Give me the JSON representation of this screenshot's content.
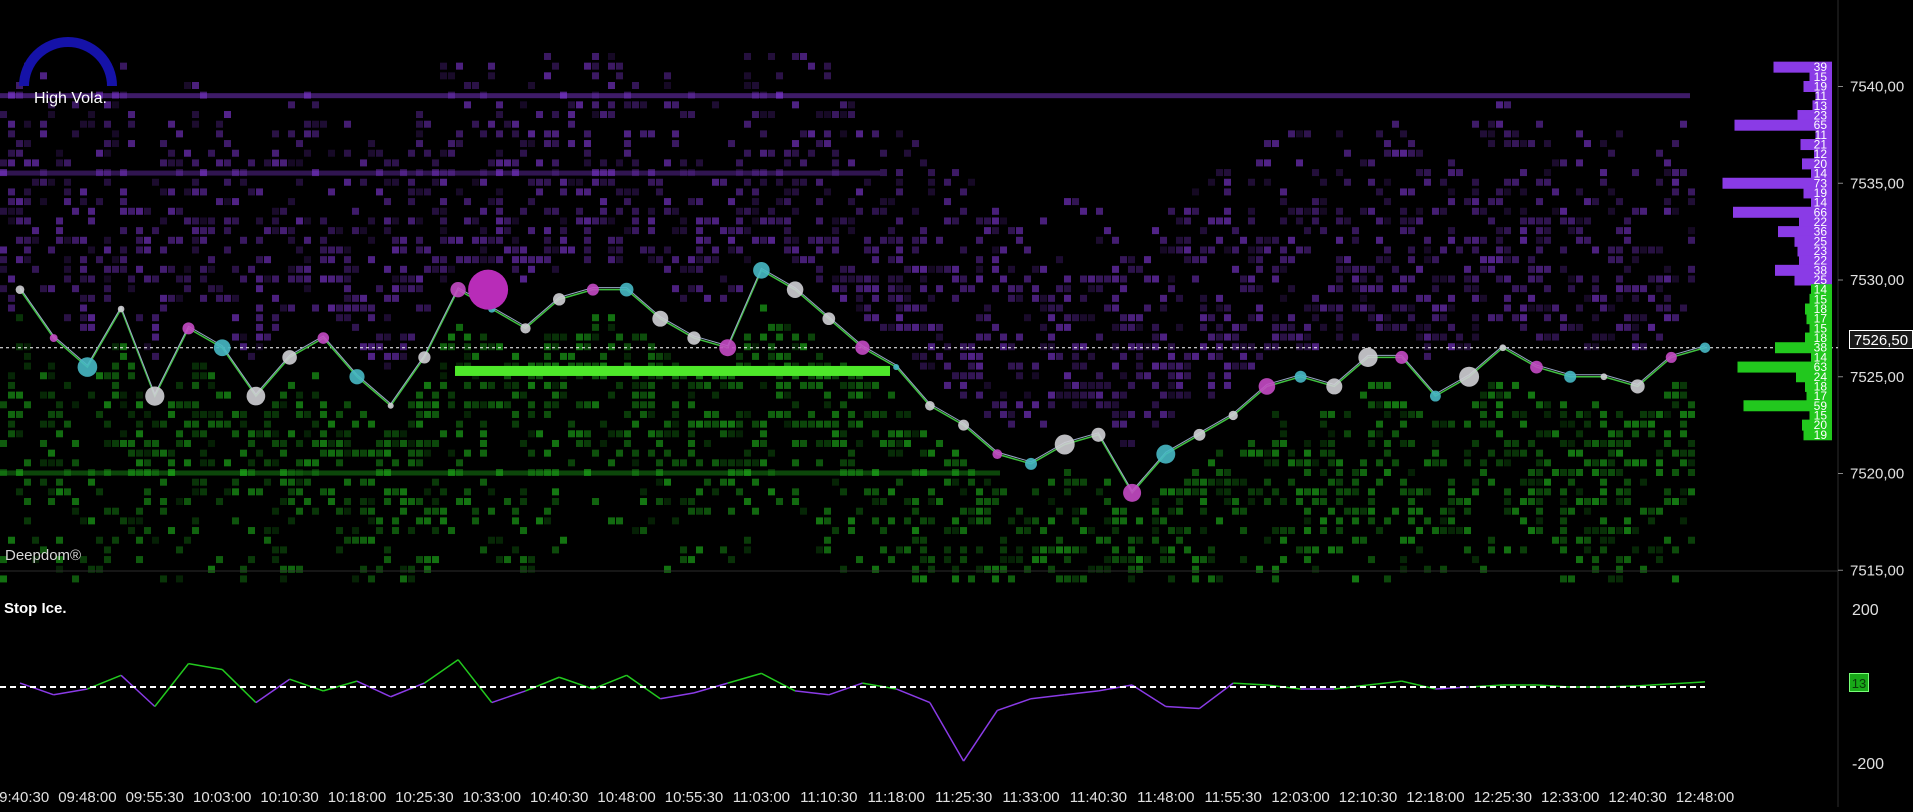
{
  "indicator_badge": {
    "label": "High Vola."
  },
  "brand": "Deepdom®",
  "lower_panel": {
    "title": "Stop Ice.",
    "axis_max": "200",
    "axis_min": "-200",
    "current_value": "13"
  },
  "price_axis": {
    "ticks": [
      "7540,00",
      "7535,00",
      "7530,00",
      "7525,00",
      "7520,00",
      "7515,00"
    ],
    "current_price": "7526,50"
  },
  "time_axis": [
    "09:40:30",
    "09:48:00",
    "09:55:30",
    "10:03:00",
    "10:10:30",
    "10:18:00",
    "10:25:30",
    "10:33:00",
    "10:40:30",
    "10:48:00",
    "10:55:30",
    "11:03:00",
    "11:10:30",
    "11:18:00",
    "11:25:30",
    "11:33:00",
    "11:40:30",
    "11:48:00",
    "11:55:30",
    "12:03:00",
    "12:10:30",
    "12:18:00",
    "12:25:30",
    "12:33:00",
    "12:40:30",
    "12:48:00"
  ],
  "colors": {
    "ask": "#8a3be6",
    "bid": "#22c81e",
    "price_line": "#3fbf3f",
    "background": "#000000"
  },
  "chart_data": [
    {
      "type": "line",
      "title": "",
      "xlabel": "",
      "ylabel": "",
      "ylim": [
        7514.5,
        7541.5
      ],
      "x": [
        "09:40:30",
        "09:44:15",
        "09:48:00",
        "09:51:45",
        "09:55:30",
        "09:59:15",
        "10:03:00",
        "10:06:45",
        "10:10:30",
        "10:14:15",
        "10:18:00",
        "10:21:45",
        "10:25:30",
        "10:29:15",
        "10:33:00",
        "10:36:45",
        "10:40:30",
        "10:44:15",
        "10:48:00",
        "10:51:45",
        "10:55:30",
        "10:59:15",
        "11:03:00",
        "11:06:45",
        "11:10:30",
        "11:14:15",
        "11:18:00",
        "11:21:45",
        "11:25:30",
        "11:29:15",
        "11:33:00",
        "11:36:45",
        "11:40:30",
        "11:44:15",
        "11:48:00",
        "11:51:45",
        "11:55:30",
        "11:59:15",
        "12:03:00",
        "12:06:45",
        "12:10:30",
        "12:14:15",
        "12:18:00",
        "12:21:45",
        "12:25:30",
        "12:29:15",
        "12:33:00",
        "12:36:45",
        "12:40:30",
        "12:44:15",
        "12:48:00"
      ],
      "series": [
        {
          "values": [
            7529.5,
            7527,
            7525.5,
            7528.5,
            7524,
            7527.5,
            7526.5,
            7524,
            7526,
            7527,
            7525,
            7523.5,
            7526,
            7529.5,
            7528.5,
            7527.5,
            7529,
            7529.5,
            7529.5,
            7528,
            7527,
            7526.5,
            7530.5,
            7529.5,
            7528,
            7526.5,
            7525.5,
            7523.5,
            7522.5,
            7521,
            7520.5,
            7521.5,
            7522,
            7519,
            7521,
            7522,
            7523,
            7524.5,
            7525,
            7524.5,
            7526,
            7526,
            7524,
            7525,
            7526.5,
            7525.5,
            7525,
            7525,
            7524.5,
            7526,
            7526.5
          ]
        }
      ]
    },
    {
      "type": "bar",
      "title": "Volume profile",
      "xlabel": "",
      "ylabel": "",
      "categories": [
        "7541,00",
        "7540,50",
        "7540,00",
        "7539,50",
        "7539,00",
        "7538,50",
        "7538,00",
        "7537,50",
        "7537,00",
        "7536,50",
        "7536,00",
        "7535,50",
        "7535,00",
        "7534,50",
        "7534,00",
        "7533,50",
        "7533,00",
        "7532,50",
        "7532,00",
        "7531,50",
        "7531,00",
        "7530,50",
        "7530,00",
        "7529,50",
        "7529,00",
        "7528,50",
        "7528,00",
        "7527,50",
        "7527,00",
        "7526,50",
        "7526,00",
        "7525,50",
        "7525,00",
        "7524,50",
        "7524,00",
        "7523,50",
        "7523,00",
        "7522,50",
        "7522,00",
        "7521,50",
        "7521,00",
        "7520,50",
        "7520,00",
        "7519,50",
        "7519,00",
        "7518,50",
        "7518,00",
        "7517,50",
        "7517,00",
        "7516,50",
        "7516,00",
        "7515,50",
        "7515,00"
      ],
      "series": [
        {
          "name": "ask",
          "values": [
            39,
            15,
            19,
            11,
            13,
            23,
            65,
            11,
            21,
            12,
            20,
            14,
            73,
            19,
            14,
            66,
            22,
            36,
            25,
            23,
            22,
            38,
            25,
            null,
            null,
            null,
            null,
            null,
            null,
            null,
            null,
            null,
            null,
            null,
            null,
            null,
            null,
            null,
            null,
            null,
            null,
            null,
            null,
            null,
            null,
            null,
            null,
            null,
            null,
            null,
            null,
            null,
            null
          ]
        },
        {
          "name": "bid",
          "values": [
            null,
            null,
            null,
            null,
            null,
            null,
            null,
            null,
            null,
            null,
            null,
            null,
            null,
            null,
            null,
            null,
            null,
            null,
            null,
            null,
            null,
            null,
            null,
            14,
            15,
            18,
            17,
            15,
            18,
            38,
            14,
            63,
            24,
            18,
            17,
            59,
            15,
            20,
            19,
            null,
            null,
            null,
            null,
            null,
            null,
            null,
            null,
            null,
            null,
            null,
            null,
            null,
            null
          ]
        }
      ],
      "xlim": [
        0,
        80
      ]
    },
    {
      "type": "line",
      "title": "Stop Ice.",
      "ylim": [
        -200,
        200
      ],
      "x": [
        "09:40:30",
        "09:44:15",
        "09:48:00",
        "09:51:45",
        "09:55:30",
        "09:59:15",
        "10:03:00",
        "10:06:45",
        "10:10:30",
        "10:14:15",
        "10:18:00",
        "10:21:45",
        "10:25:30",
        "10:29:15",
        "10:33:00",
        "10:36:45",
        "10:40:30",
        "10:44:15",
        "10:48:00",
        "10:51:45",
        "10:55:30",
        "10:59:15",
        "11:03:00",
        "11:06:45",
        "11:10:30",
        "11:14:15",
        "11:18:00",
        "11:21:45",
        "11:25:30",
        "11:29:15",
        "11:33:00",
        "11:36:45",
        "11:40:30",
        "11:44:15",
        "11:48:00",
        "11:51:45",
        "11:55:30",
        "11:59:15",
        "12:03:00",
        "12:06:45",
        "12:10:30",
        "12:14:15",
        "12:18:00",
        "12:21:45",
        "12:25:30",
        "12:29:15",
        "12:33:00",
        "12:36:45",
        "12:40:30",
        "12:44:15",
        "12:48:00"
      ],
      "series": [
        {
          "values": [
            10,
            -20,
            -5,
            30,
            -50,
            60,
            45,
            -40,
            20,
            -10,
            15,
            -25,
            10,
            70,
            -40,
            -10,
            25,
            -5,
            30,
            -30,
            -15,
            10,
            35,
            -10,
            -20,
            10,
            -5,
            -40,
            -190,
            -60,
            -30,
            -20,
            -10,
            5,
            -50,
            -55,
            10,
            5,
            -5,
            -5,
            5,
            15,
            -5,
            0,
            5,
            5,
            0,
            0,
            3,
            8,
            13
          ]
        }
      ]
    }
  ]
}
